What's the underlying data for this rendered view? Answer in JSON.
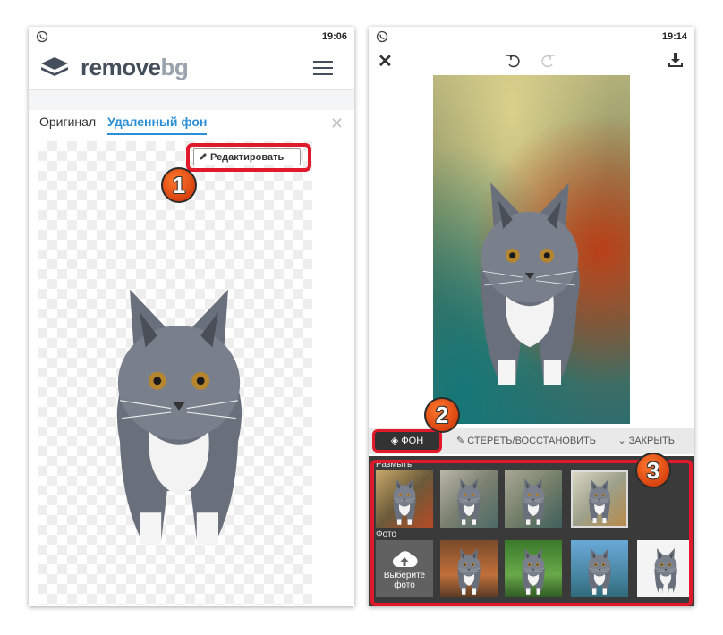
{
  "left": {
    "status": {
      "time": "19:06"
    },
    "brand": {
      "part1": "remove",
      "part2": "bg"
    },
    "tabs": [
      {
        "label": "Оригинал"
      },
      {
        "label": "Удаленный фон"
      }
    ],
    "edit_button": {
      "label": "Редактировать"
    },
    "step_badge": "1"
  },
  "right": {
    "status": {
      "time": "19:14"
    },
    "toolbar": {
      "background_tab": "ФОН",
      "erase_tab": "СТЕРЕТЬ/ВОССТАНОВИТЬ",
      "close_tab": "ЗАКРЫТЬ"
    },
    "panel": {
      "blur_label": "Размыть",
      "photo_label": "Фото",
      "choose_photo": "Выберите фото"
    },
    "step_badges": [
      "2",
      "3"
    ]
  },
  "icons": {
    "status": "viber-icon",
    "logo": "removebg-logo-icon",
    "menu": "hamburger-menu-icon",
    "close": "close-icon",
    "edit": "pencil-icon",
    "undo": "undo-icon",
    "redo": "redo-icon",
    "download": "download-icon",
    "layers": "layers-icon",
    "brush": "brush-icon",
    "chevron": "chevron-down-icon",
    "upload": "cloud-upload-icon"
  },
  "colors": {
    "accent_blue": "#2b8fd7",
    "highlight_red": "#e1192b",
    "badge_orange": "#ee5a1e",
    "panel_dark": "#3a3a3a"
  }
}
